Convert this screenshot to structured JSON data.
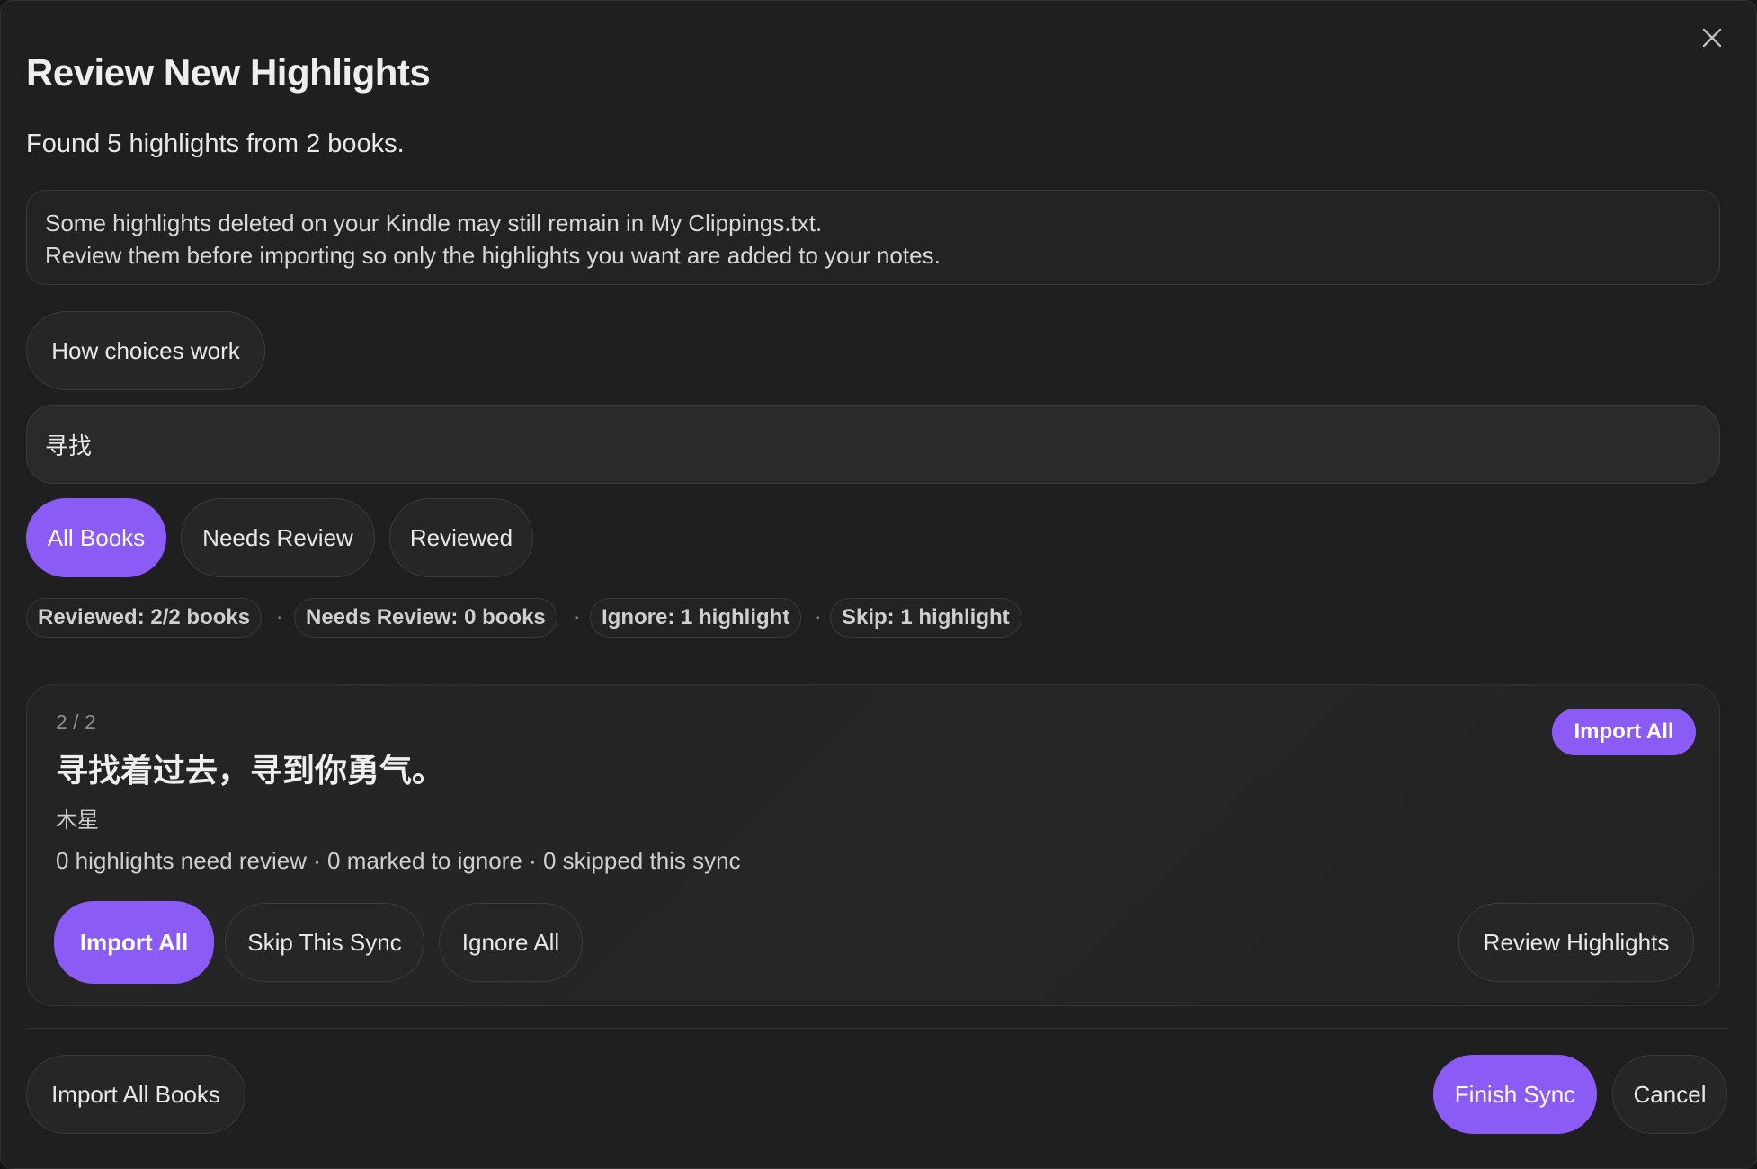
{
  "modal": {
    "title": "Review New Highlights",
    "summary": "Found 5 highlights from 2 books.",
    "notice_line1": "Some highlights deleted on your Kindle may still remain in My Clippings.txt.",
    "notice_line2": "Review them before importing so only the highlights you want are added to your notes.",
    "how_choices_label": "How choices work",
    "close_icon": "close-icon"
  },
  "search": {
    "value": "寻找",
    "placeholder": ""
  },
  "filters": {
    "all_books": "All Books",
    "needs_review": "Needs Review",
    "reviewed": "Reviewed",
    "active": "All Books"
  },
  "stats": {
    "reviewed": "Reviewed: 2/2 books",
    "needs_review": "Needs Review: 0 books",
    "ignore": "Ignore: 1 highlight",
    "skip": "Skip: 1 highlight",
    "separator": "·"
  },
  "book": {
    "counter": "2 / 2",
    "title": "寻找着过去，寻到你勇气。",
    "author": "木星",
    "stats": "0 highlights need review · 0 marked to ignore · 0 skipped this sync",
    "badge_label": "Import All",
    "import_all_label": "Import All",
    "skip_label": "Skip This Sync",
    "ignore_label": "Ignore All",
    "review_label": "Review Highlights"
  },
  "footer": {
    "import_all_books_label": "Import All Books",
    "finish_sync_label": "Finish Sync",
    "cancel_label": "Cancel"
  },
  "colors": {
    "accent": "#8a5cf5",
    "background": "#1f1f1f"
  }
}
